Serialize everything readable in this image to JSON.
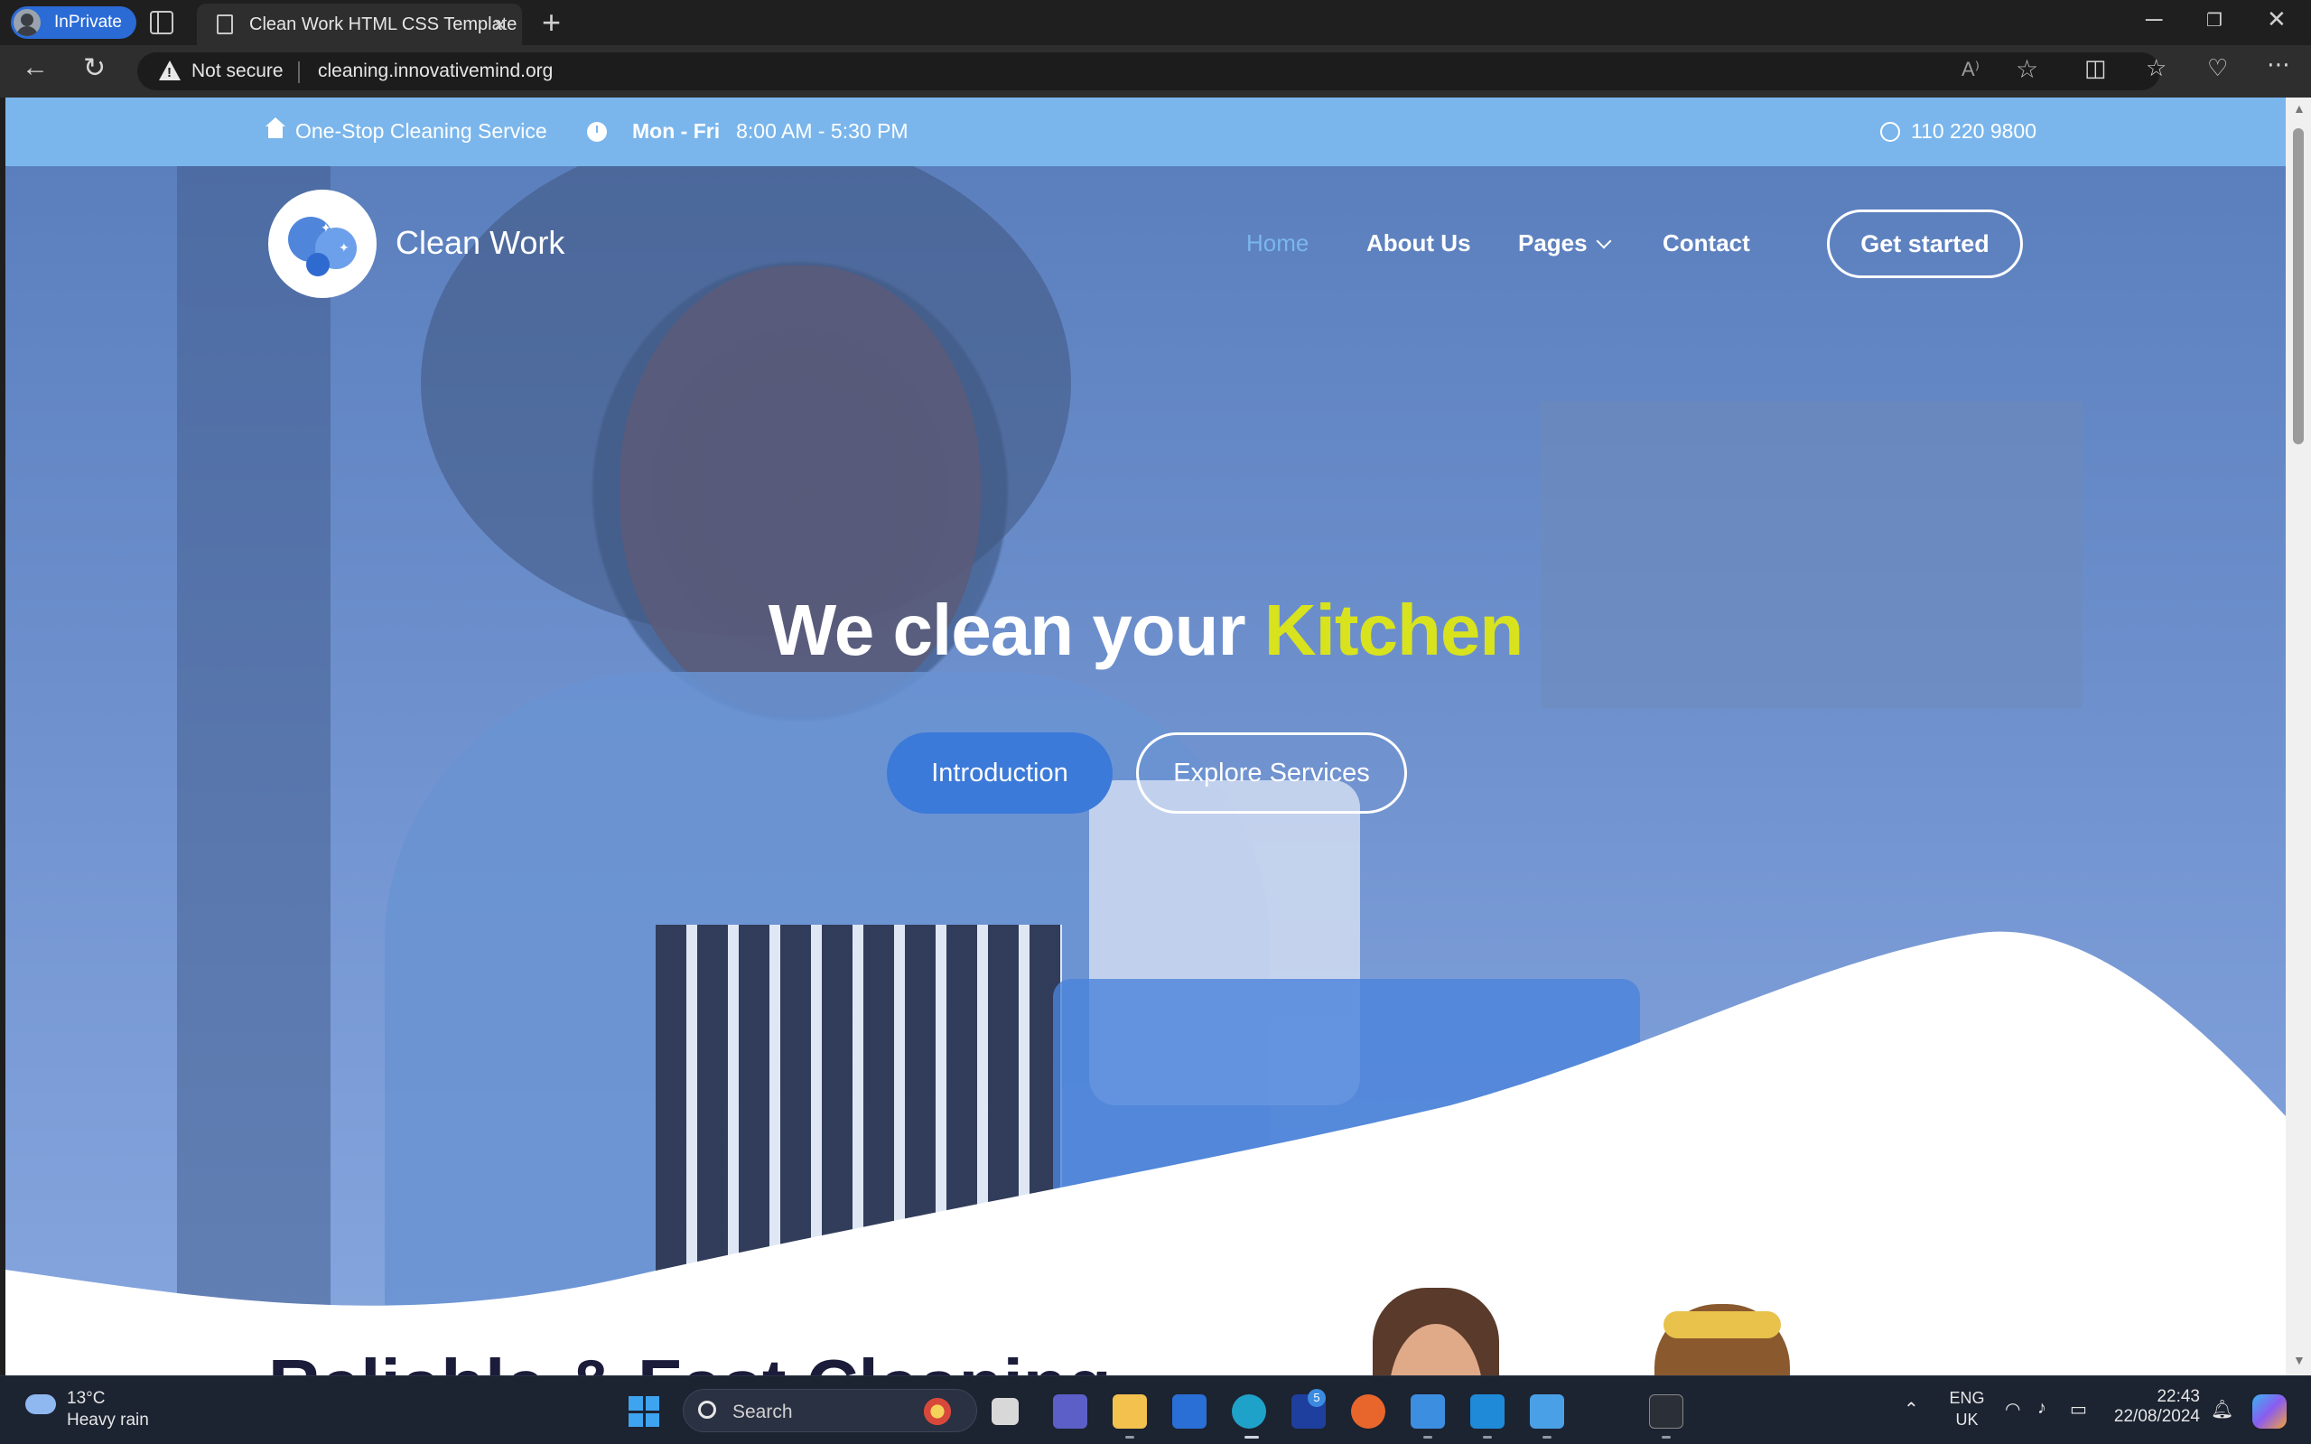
{
  "browser": {
    "profile_label": "InPrivate",
    "tab_title": "Clean Work HTML CSS Template",
    "security_label": "Not secure",
    "url": "cleaning.innovativemind.org"
  },
  "topbar": {
    "service": "One-Stop Cleaning Service",
    "days": "Mon - Fri",
    "hours": "8:00 AM - 5:30 PM",
    "phone": "110 220 9800"
  },
  "site": {
    "brand": "Clean Work",
    "nav": [
      {
        "label": "Home",
        "active": true
      },
      {
        "label": "About Us",
        "active": false
      },
      {
        "label": "Pages",
        "active": false
      },
      {
        "label": "Contact",
        "active": false
      }
    ],
    "cta": "Get started"
  },
  "hero": {
    "headline_prefix": "We clean your ",
    "headline_highlight": "Kitchen",
    "btn_primary": "Introduction",
    "btn_secondary": "Explore Services",
    "highlight_color": "#d8e31e",
    "accent_color": "#7ab6ec"
  },
  "section": {
    "title": "Reliable & Fast Cleaning"
  },
  "taskbar": {
    "weather_temp": "13°C",
    "weather_desc": "Heavy rain",
    "search_label": "Search",
    "lang_line1": "ENG",
    "lang_line2": "UK",
    "time": "22:43",
    "date": "22/08/2024",
    "badge_count": "5"
  }
}
